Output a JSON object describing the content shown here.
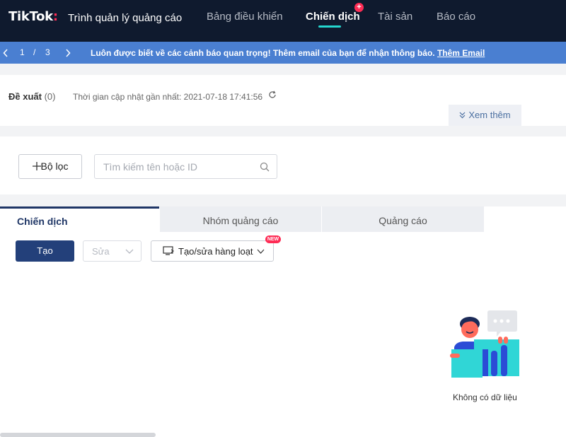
{
  "header": {
    "brand": "TikTok",
    "brand_colon": ":",
    "subtitle": "Trình quản lý quảng cáo",
    "nav": [
      "Bảng điều khiển",
      "Chiến dịch",
      "Tài sản",
      "Báo cáo"
    ],
    "active_nav": "Chiến dịch",
    "badge": "+"
  },
  "banner": {
    "page_current": "1",
    "page_sep": "/",
    "page_total": "3",
    "message": "Luôn được biết về các cảnh báo quan trọng! Thêm email của bạn để nhận thông báo.",
    "link": "Thêm Email"
  },
  "recommend": {
    "title": "Đề xuất",
    "count": "(0)",
    "updated": "Thời gian cập nhật gần nhất: 2021-07-18 17:41:56",
    "more": "Xem thêm"
  },
  "filter": {
    "filter_button": "Bộ lọc",
    "search_placeholder": "Tìm kiếm tên hoặc ID"
  },
  "tabs": [
    "Chiến dịch",
    "Nhóm quảng cáo",
    "Quảng cáo"
  ],
  "toolbar": {
    "create": "Tạo",
    "edit": "Sửa",
    "bulk": "Tạo/sửa hàng loạt",
    "new_badge": "NEW"
  },
  "empty_state": {
    "text": "Không có dữ liệu"
  },
  "colors": {
    "header_bg": "#0f1a2e",
    "banner_bg": "#4a7fd1",
    "accent": "#fe2c55",
    "primary_button": "#23407a",
    "nav_underline": "#25d8d0"
  }
}
